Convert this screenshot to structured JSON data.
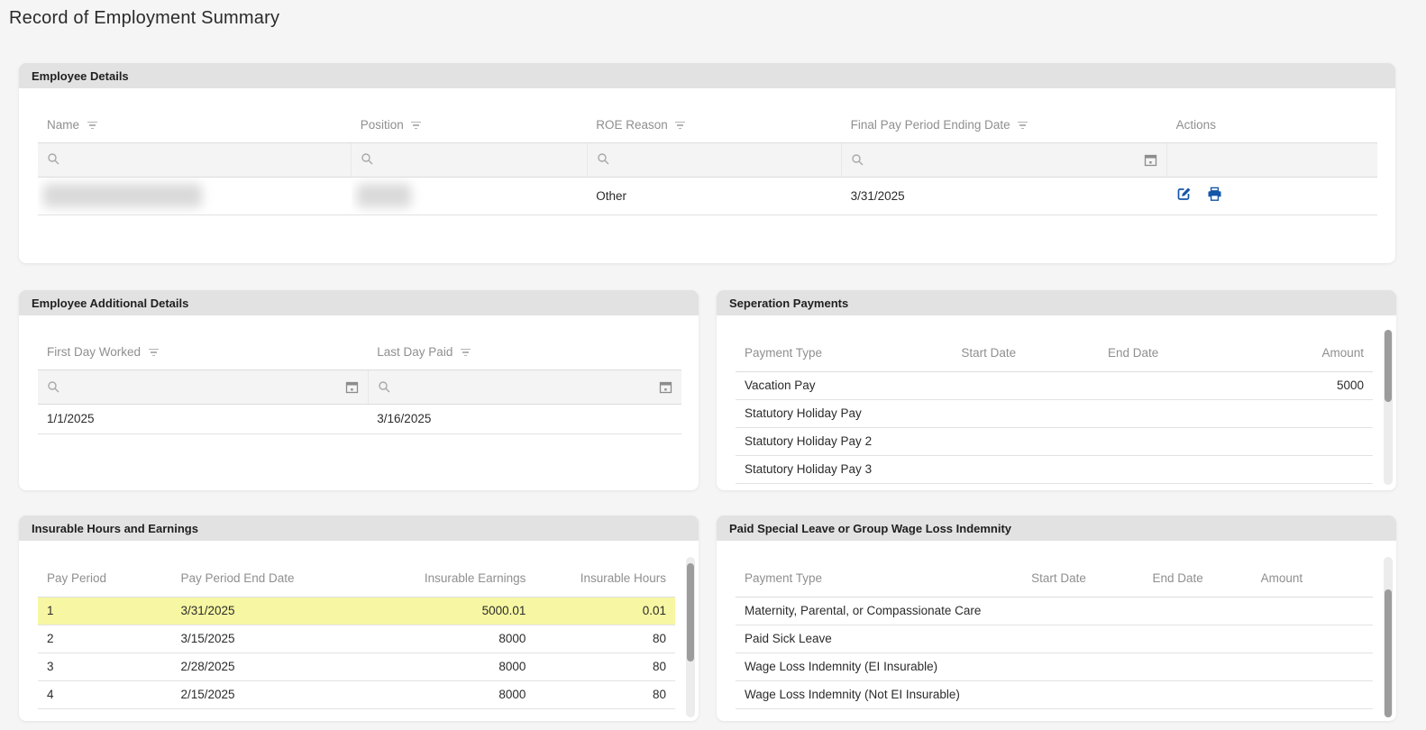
{
  "page": {
    "title": "Record of Employment Summary"
  },
  "colors": {
    "accent_blue": "#1456a8",
    "highlight_yellow": "#f7f7a3",
    "panel_header_gray": "#e2e2e2",
    "page_background": "#f5f5f5"
  },
  "employee_details": {
    "title": "Employee Details",
    "columns": {
      "name": "Name",
      "position": "Position",
      "roe_reason": "ROE Reason",
      "final_pay_period_ending_date": "Final Pay Period Ending Date",
      "actions": "Actions"
    },
    "row": {
      "roe_reason": "Other",
      "final_pay_period_ending_date": "3/31/2025"
    },
    "action_icons": {
      "edit": "edit-icon",
      "print": "print-icon"
    }
  },
  "employee_additional_details": {
    "title": "Employee Additional Details",
    "columns": {
      "first_day_worked": "First Day Worked",
      "last_day_paid": "Last Day Paid"
    },
    "row": {
      "first_day_worked": "1/1/2025",
      "last_day_paid": "3/16/2025"
    }
  },
  "separation_payments": {
    "title": "Seperation Payments",
    "columns": [
      "Payment Type",
      "Start Date",
      "End Date",
      "Amount"
    ],
    "rows": [
      {
        "payment_type": "Vacation Pay",
        "start_date": "",
        "end_date": "",
        "amount": "5000"
      },
      {
        "payment_type": "Statutory Holiday Pay",
        "start_date": "",
        "end_date": "",
        "amount": ""
      },
      {
        "payment_type": "Statutory Holiday Pay 2",
        "start_date": "",
        "end_date": "",
        "amount": ""
      },
      {
        "payment_type": "Statutory Holiday Pay 3",
        "start_date": "",
        "end_date": "",
        "amount": ""
      }
    ]
  },
  "insurable_hours_and_earnings": {
    "title": "Insurable Hours and Earnings",
    "columns": [
      "Pay Period",
      "Pay Period End Date",
      "Insurable Earnings",
      "Insurable Hours"
    ],
    "rows": [
      {
        "pay_period": "1",
        "pay_period_end_date": "3/31/2025",
        "insurable_earnings": "5000.01",
        "insurable_hours": "0.01",
        "highlighted": true
      },
      {
        "pay_period": "2",
        "pay_period_end_date": "3/15/2025",
        "insurable_earnings": "8000",
        "insurable_hours": "80",
        "highlighted": false
      },
      {
        "pay_period": "3",
        "pay_period_end_date": "2/28/2025",
        "insurable_earnings": "8000",
        "insurable_hours": "80",
        "highlighted": false
      },
      {
        "pay_period": "4",
        "pay_period_end_date": "2/15/2025",
        "insurable_earnings": "8000",
        "insurable_hours": "80",
        "highlighted": false
      }
    ]
  },
  "paid_special_leave": {
    "title": "Paid Special Leave or Group Wage Loss Indemnity",
    "columns": [
      "Payment Type",
      "Start Date",
      "End Date",
      "Amount"
    ],
    "rows": [
      {
        "payment_type": "Maternity, Parental, or Compassionate Care",
        "start_date": "",
        "end_date": "",
        "amount": ""
      },
      {
        "payment_type": "Paid Sick Leave",
        "start_date": "",
        "end_date": "",
        "amount": ""
      },
      {
        "payment_type": "Wage Loss Indemnity (EI Insurable)",
        "start_date": "",
        "end_date": "",
        "amount": ""
      },
      {
        "payment_type": "Wage Loss Indemnity (Not EI Insurable)",
        "start_date": "",
        "end_date": "",
        "amount": ""
      }
    ]
  }
}
